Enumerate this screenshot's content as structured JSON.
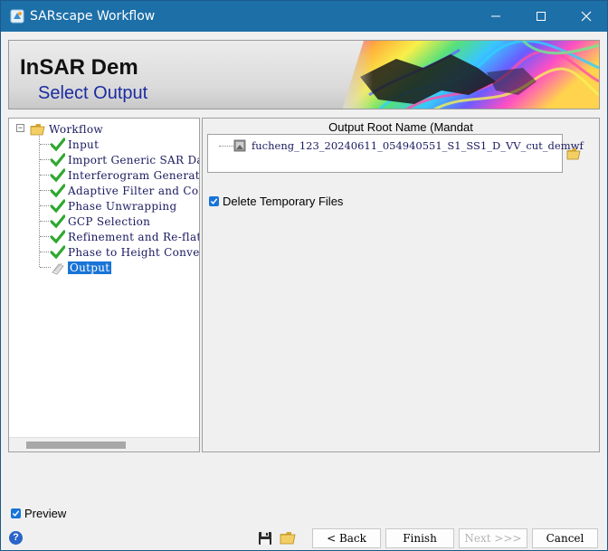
{
  "window": {
    "title": "SARscape Workflow",
    "accent": "#1d6fa8"
  },
  "header": {
    "title": "InSAR Dem",
    "subtitle": "Select Output"
  },
  "tree": {
    "root": "Workflow",
    "items": [
      {
        "label": "Input",
        "status": "done"
      },
      {
        "label": "Import Generic SAR Data",
        "status": "done"
      },
      {
        "label": "Interferogram Generatio",
        "status": "done"
      },
      {
        "label": "Adaptive Filter and Col",
        "status": "done"
      },
      {
        "label": "Phase Unwrapping",
        "status": "done"
      },
      {
        "label": "GCP Selection",
        "status": "done"
      },
      {
        "label": "Refinement and Re-flatt",
        "status": "done"
      },
      {
        "label": "Phase to Height Convers",
        "status": "done"
      },
      {
        "label": "Output",
        "status": "current",
        "selected": true
      }
    ]
  },
  "output": {
    "title": "Output Root Name (Mandat",
    "filename": "fucheng_123_20240611_054940551_S1_SS1_D_VV_cut_demwf",
    "delete_temp_label": "Delete Temporary Files",
    "delete_temp_checked": true
  },
  "footer": {
    "preview_label": "Preview",
    "preview_checked": true,
    "back_label": "< Back",
    "finish_label": "Finish",
    "next_label": "Next >>>",
    "next_enabled": false,
    "cancel_label": "Cancel",
    "help_label": "?"
  }
}
